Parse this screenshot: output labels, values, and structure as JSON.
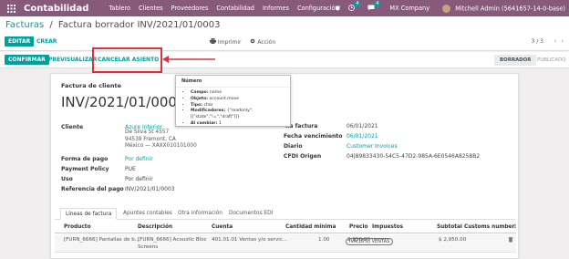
{
  "nav": {
    "brand": "Contabilidad",
    "menu": [
      "Tablero",
      "Clientes",
      "Proveedores",
      "Contabilidad",
      "Informes",
      "Configuración"
    ],
    "messages_count": "4",
    "activities_count": "4",
    "company": "MX Company",
    "user": "Mitchell Admin (5641657-14-0-base)"
  },
  "breadcrumb": {
    "parent": "Facturas",
    "separator": "/",
    "current": "Factura borrador INV/2021/01/0003"
  },
  "toolbar": {
    "edit_label": "EDITAR",
    "create_label": "CREAR",
    "print_label": "Imprimir",
    "action_label": "Acción",
    "pager": "3 / 3",
    "prev": "‹",
    "next": "›"
  },
  "statusbar": {
    "confirm_label": "CONFIRMAR",
    "preview_label": "PREVISUALIZAR",
    "cancel_label": "CANCELAR ASIENTO",
    "states": [
      "BORRADOR",
      "PUBLICADO"
    ]
  },
  "tooltip": {
    "title": "Número",
    "rows": [
      {
        "key": "Campo:",
        "value": "name"
      },
      {
        "key": "Objeto:",
        "value": "account.move"
      },
      {
        "key": "Tipo:",
        "value": "char"
      },
      {
        "key": "Modificadores:",
        "value": "{\"readonly\":[[\"state\",\"!=\",\"draft\"]]}"
      },
      {
        "key": "Al cambiar:",
        "value": "1"
      }
    ]
  },
  "form": {
    "doc_type": "Factura de cliente",
    "doc_name": "INV/2021/01/0003",
    "customer_label": "Cliente",
    "customer": "Azure Interior",
    "address": [
      "De Silva St 4557",
      "94538 Fremont, CA",
      "México — XAXX010101000"
    ],
    "payment_form_label": "Forma de pago",
    "payment_form": "Por definir",
    "payment_policy_label": "Payment Policy",
    "payment_policy": "PUE",
    "usage_label": "Uso",
    "usage": "Por definir",
    "payment_ref_label": "Referencia del pago",
    "payment_ref": "INV/2021/01/0003",
    "invoice_date_label": "ha factura",
    "invoice_date": "06/01/2021",
    "due_date_label": "Fecha vencimiento",
    "due_date": "06/01/2021",
    "journal_label": "Diario",
    "journal": "Customer Invoices",
    "cfdi_label": "CFDI Origen",
    "cfdi": "04|89833430-54C5-47D2-985A-6E0546A8258B2"
  },
  "tabs": [
    "Líneas de factura",
    "Apuntes contables",
    "Otra información",
    "Documentos EDI"
  ],
  "table": {
    "headers": [
      "Producto",
      "Descripción",
      "Cuenta",
      "Cantidad mínima",
      "Precio",
      "Impuestos",
      "Subtotal",
      "Customs number"
    ],
    "row": {
      "product": "[FURN_6666] Pantallas de b...",
      "description": "[FURN_6666] Acoustic Bloc",
      "description2": "Screens",
      "account": "401.01.01 Ventas y/o servic...",
      "qty": "1.00",
      "price": "2,950.00",
      "tax": "IVA(16%) VENTAS",
      "subtotal": "$ 2,950.00"
    }
  },
  "colors": {
    "brand": "#875a7b",
    "primary": "#00a09d",
    "highlight": "#d9333c"
  }
}
